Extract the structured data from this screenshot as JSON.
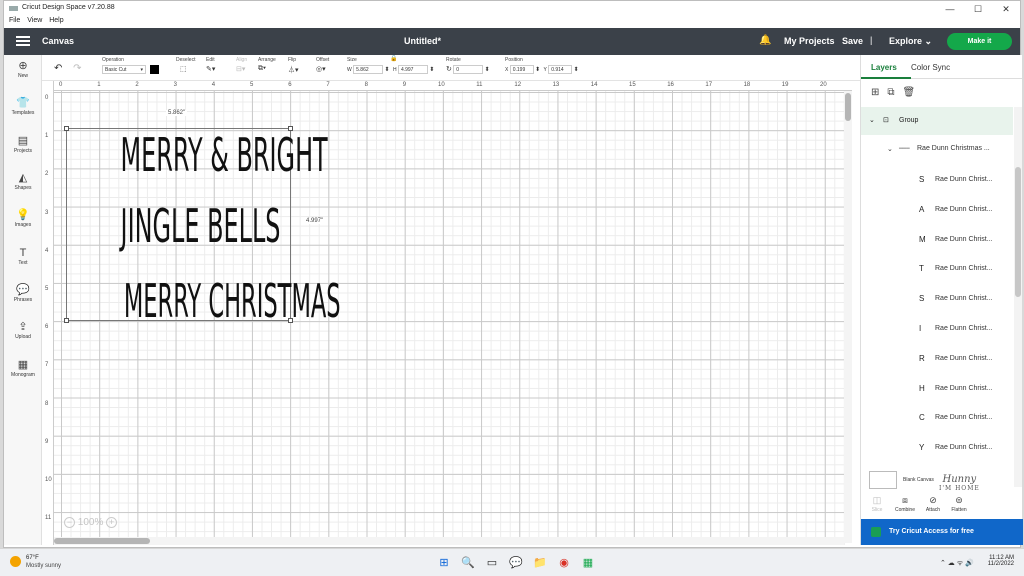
{
  "window": {
    "title": "Cricut Design Space  v7.20.88",
    "menu": [
      "File",
      "View",
      "Help"
    ],
    "controls": {
      "minimize": "—",
      "maximize": "☐",
      "close": "✕"
    }
  },
  "header": {
    "canvas_label": "Canvas",
    "doc_title": "Untitled*",
    "my_projects": "My Projects",
    "save": "Save",
    "separator": "|",
    "explore": "Explore",
    "explore_chevron": "⌄",
    "make_it": "Make it",
    "bell": "🔔"
  },
  "leftbar": [
    {
      "label": "New",
      "icon": "⊕"
    },
    {
      "label": "Templates",
      "icon": "👕"
    },
    {
      "label": "Projects",
      "icon": "▤"
    },
    {
      "label": "Shapes",
      "icon": "◭"
    },
    {
      "label": "Images",
      "icon": "💡"
    },
    {
      "label": "Text",
      "icon": "T"
    },
    {
      "label": "Phrases",
      "icon": "💬"
    },
    {
      "label": "Upload",
      "icon": "⇪"
    },
    {
      "label": "Monogram",
      "icon": "▦"
    }
  ],
  "toolbar": {
    "undo": "↶",
    "redo": "↷",
    "operation_label": "Operation",
    "operation_value": "Basic Cut",
    "operation_color": "#000000",
    "deselect": "Deselect",
    "edit": "Edit",
    "align": "Align",
    "arrange": "Arrange",
    "flip": "Flip",
    "offset": "Offset",
    "size": "Size",
    "w_label": "W",
    "w_value": "5.862",
    "h_label": "H",
    "h_value": "4.997",
    "rotate": "Rotate",
    "rotate_value": "0",
    "position": "Position",
    "x_label": "X",
    "x_value": "0.199",
    "y_label": "Y",
    "y_value": "0.914",
    "deselect_icon": "⬚",
    "edit_icon": "✎",
    "align_icon": "⊟",
    "arrange_icon": "⧉",
    "flip_icon": "⏃",
    "offset_icon": "◎",
    "lock_icon": "🔒",
    "rotate_icon": "↻",
    "spin": "⬍",
    "dropdown": "▾"
  },
  "ruler": {
    "top": [
      "0",
      "1",
      "2",
      "3",
      "4",
      "5",
      "6",
      "7",
      "8",
      "9",
      "10",
      "11",
      "12",
      "13",
      "14",
      "15",
      "16",
      "17",
      "18",
      "19",
      "20"
    ],
    "left": [
      "0",
      "1",
      "2",
      "3",
      "4",
      "5",
      "6",
      "7",
      "8",
      "9",
      "10",
      "11"
    ]
  },
  "design": {
    "lines": [
      "MERRY & BRIGHT",
      "JINGLE BELLS",
      "MERRY CHRISTMAS"
    ],
    "width_label": "5.862\"",
    "height_label": "4.997\""
  },
  "zoom": {
    "minus": "−",
    "value": "100%",
    "plus": "+"
  },
  "panel": {
    "tab_layers": "Layers",
    "tab_color_sync": "Color Sync",
    "tools": [
      "⊞",
      "⧉",
      "🗑"
    ],
    "group_label": "Group",
    "group_chevron": "⌄",
    "group_icon": "⊡",
    "sub_group": "Rae Dunn Christmas ...",
    "sub_chevron": "⌄",
    "sub_icon": "═══",
    "layers": [
      {
        "glyph": "S",
        "name": "Rae Dunn Christ..."
      },
      {
        "glyph": "A",
        "name": "Rae Dunn Christ..."
      },
      {
        "glyph": "M",
        "name": "Rae Dunn Christ..."
      },
      {
        "glyph": "T",
        "name": "Rae Dunn Christ..."
      },
      {
        "glyph": "S",
        "name": "Rae Dunn Christ..."
      },
      {
        "glyph": "I",
        "name": "Rae Dunn Christ..."
      },
      {
        "glyph": "R",
        "name": "Rae Dunn Christ..."
      },
      {
        "glyph": "H",
        "name": "Rae Dunn Christ..."
      },
      {
        "glyph": "C",
        "name": "Rae Dunn Christ..."
      },
      {
        "glyph": "Y",
        "name": "Rae Dunn Christ..."
      }
    ],
    "blank_canvas": "Blank Canvas",
    "bottom_tools": [
      {
        "label": "Slice",
        "icon": "◫",
        "enabled": false
      },
      {
        "label": "Combine",
        "icon": "⧈",
        "enabled": true
      },
      {
        "label": "Attach",
        "icon": "⊘",
        "enabled": true
      },
      {
        "label": "Flatten",
        "icon": "⊜",
        "enabled": true
      }
    ],
    "watermark_line1": "Hunny",
    "watermark_line2": "I'M HOME",
    "access_text": "Try Cricut Access for free"
  },
  "taskbar": {
    "temp": "67°F",
    "weather": "Mostly sunny",
    "icons": [
      "⊞",
      "🔍",
      "▭",
      "💬",
      "📁",
      "◉",
      "▦"
    ],
    "tray": "⌃ ☁ ᯤ 🔊",
    "time": "11:12 AM",
    "date": "11/2/2022"
  }
}
